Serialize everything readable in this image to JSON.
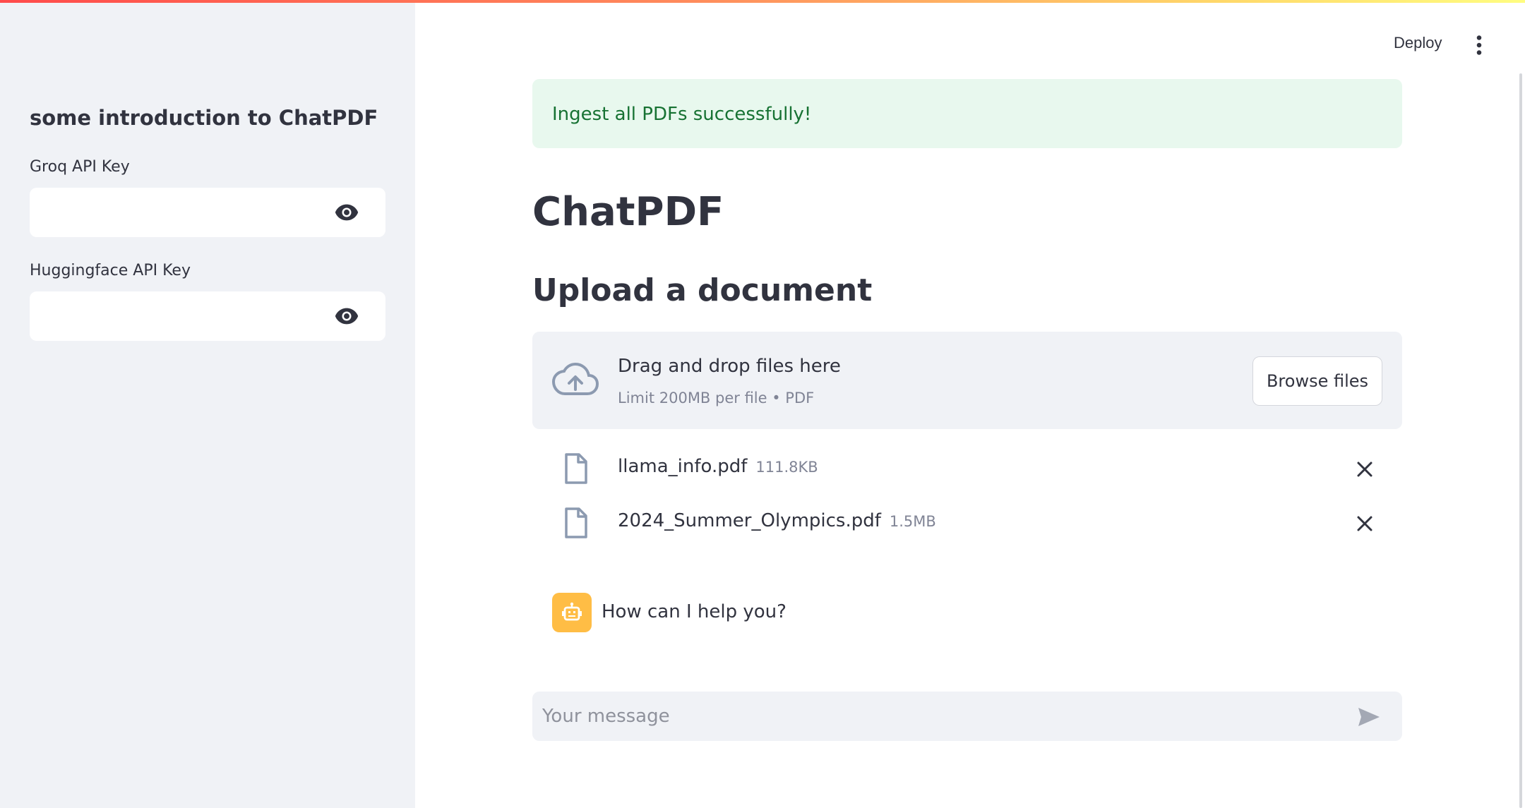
{
  "sidebar": {
    "title": "some introduction to ChatPDF",
    "groq_label": "Groq API Key",
    "groq_value": "",
    "hf_label": "Huggingface API Key",
    "hf_value": ""
  },
  "header": {
    "deploy_label": "Deploy"
  },
  "main": {
    "success_message": "Ingest all PDFs successfully!",
    "title": "ChatPDF",
    "subtitle": "Upload a document",
    "uploader": {
      "drag_text": "Drag and drop files here",
      "limit_text": "Limit 200MB per file • PDF",
      "browse_label": "Browse files"
    },
    "files": [
      {
        "name": "llama_info.pdf",
        "size": "111.8KB"
      },
      {
        "name": "2024_Summer_Olympics.pdf",
        "size": "1.5MB"
      }
    ],
    "assistant_message": "How can I help you?",
    "chat_placeholder": "Your message"
  },
  "colors": {
    "success_bg": "#e8f8ee",
    "success_text": "#177233",
    "avatar_bg": "#ffbd45",
    "sidebar_bg": "#f0f2f6",
    "icon_muted": "#8c9ab0"
  },
  "icons": {
    "password_toggle": "eye-icon",
    "menu": "kebab-menu-icon",
    "upload": "cloud-upload-icon",
    "file": "file-icon",
    "remove": "close-icon",
    "assistant": "robot-icon",
    "send": "send-icon"
  }
}
